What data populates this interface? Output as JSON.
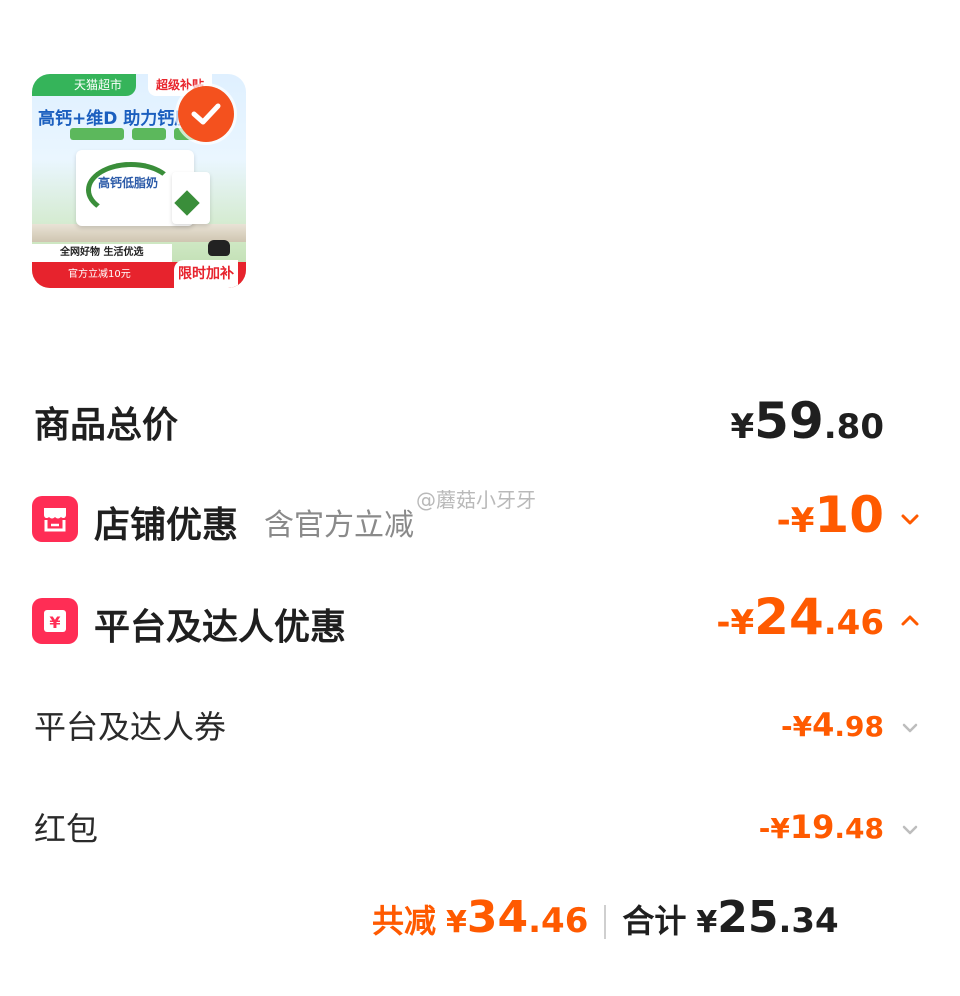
{
  "product": {
    "image_text": {
      "store_tag": "天猫超市",
      "promo_tag": "超级补贴",
      "headline": "高钙+维D 助力钙质",
      "pack_name": "高钙低脂奶",
      "bottom_left": "全网好物 生活优选",
      "bottom_red_left": "官方立减10元",
      "bottom_red_right": "限时加补"
    }
  },
  "summary": {
    "goods_total": {
      "label": "商品总价",
      "currency": "¥",
      "int": "59",
      "dec": ".80"
    },
    "shop_discount": {
      "label": "店铺优惠",
      "note": "含官方立减",
      "currency": "-¥",
      "int": "10",
      "dec": "",
      "icon": "shop-icon",
      "expanded": false
    },
    "platform_discount": {
      "label": "平台及达人优惠",
      "currency": "-¥",
      "int": "24",
      "dec": ".46",
      "icon": "coupon-icon",
      "expanded": true,
      "items": [
        {
          "label": "平台及达人券",
          "currency": "-¥",
          "int": "4",
          "dec": ".98"
        },
        {
          "label": "红包",
          "currency": "-¥",
          "int": "19",
          "dec": ".48"
        }
      ]
    },
    "footer": {
      "saved_label": "共减",
      "saved_currency": "¥",
      "saved_int": "34",
      "saved_dec": ".46",
      "total_label": "合计",
      "total_currency": "¥",
      "total_int": "25",
      "total_dec": ".34"
    }
  },
  "watermark": "@蘑菇小牙牙",
  "colors": {
    "accent": "#ff5a00",
    "icon_bg": "#ff2d55",
    "check": "#f4511e"
  }
}
